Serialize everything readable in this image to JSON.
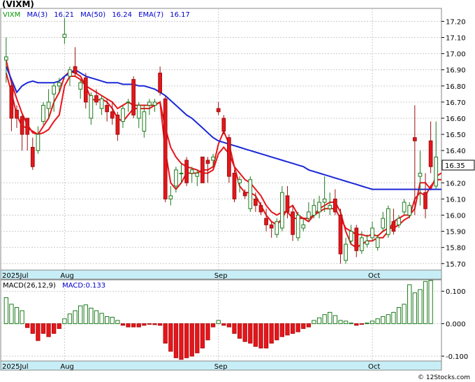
{
  "chart_data": {
    "type": "candlestick",
    "symbol": "(VIXM)",
    "legend": [
      {
        "label": "VIXM",
        "color": "#009900"
      },
      {
        "label": "MA(3)",
        "color": "#0000cc"
      },
      {
        "label": "16.21",
        "color": "#0000cc"
      },
      {
        "label": "MA(50)",
        "color": "#0000cc"
      },
      {
        "label": "16.24",
        "color": "#0000cc"
      },
      {
        "label": "EMA(7)",
        "color": "#0000cc"
      },
      {
        "label": "16.17",
        "color": "#0000cc"
      }
    ],
    "last_price_label": "16.35",
    "y_ticks": [
      "17.20",
      "17.10",
      "17.00",
      "16.90",
      "16.80",
      "16.70",
      "16.60",
      "16.50",
      "16.40",
      "16.35",
      "16.20",
      "16.10",
      "16.00",
      "15.90",
      "15.80",
      "15.70"
    ],
    "ylim": [
      15.66,
      17.28
    ],
    "x_labels": [
      {
        "text": "2025Jul",
        "index": 0
      },
      {
        "text": "Aug",
        "index": 11.5
      },
      {
        "text": "Sep",
        "index": 40.5
      },
      {
        "text": "Oct",
        "index": 69.5
      }
    ],
    "ohlc": [
      [
        16.96,
        17.1,
        16.82,
        16.98
      ],
      [
        16.8,
        16.82,
        16.52,
        16.6
      ],
      [
        16.65,
        16.68,
        16.54,
        16.6
      ],
      [
        16.61,
        16.62,
        16.4,
        16.5
      ],
      [
        16.6,
        16.6,
        16.4,
        16.5
      ],
      [
        16.42,
        16.48,
        16.28,
        16.3
      ],
      [
        16.4,
        16.55,
        16.38,
        16.5
      ],
      [
        16.58,
        16.7,
        16.56,
        16.68
      ],
      [
        16.66,
        16.78,
        16.6,
        16.7
      ],
      [
        16.75,
        16.82,
        16.64,
        16.8
      ],
      [
        16.8,
        16.85,
        16.76,
        16.82
      ],
      [
        17.1,
        17.22,
        17.06,
        17.12
      ],
      [
        16.86,
        16.92,
        16.8,
        16.9
      ],
      [
        16.92,
        17.04,
        16.86,
        16.88
      ],
      [
        16.78,
        16.84,
        16.72,
        16.82
      ],
      [
        16.85,
        16.88,
        16.66,
        16.7
      ],
      [
        16.6,
        16.76,
        16.56,
        16.74
      ],
      [
        16.74,
        16.78,
        16.68,
        16.7
      ],
      [
        16.66,
        16.74,
        16.62,
        16.72
      ],
      [
        16.68,
        16.72,
        16.58,
        16.64
      ],
      [
        16.64,
        16.7,
        16.56,
        16.6
      ],
      [
        16.62,
        16.64,
        16.46,
        16.5
      ],
      [
        16.58,
        16.68,
        16.54,
        16.66
      ],
      [
        16.7,
        16.72,
        16.64,
        16.7
      ],
      [
        16.84,
        16.86,
        16.6,
        16.62
      ],
      [
        16.6,
        16.7,
        16.54,
        16.68
      ],
      [
        16.52,
        16.68,
        16.48,
        16.64
      ],
      [
        16.68,
        16.72,
        16.62,
        16.7
      ],
      [
        16.68,
        16.72,
        16.64,
        16.7
      ],
      [
        16.88,
        16.92,
        16.74,
        16.76
      ],
      [
        16.72,
        16.74,
        16.08,
        16.1
      ],
      [
        16.1,
        16.18,
        16.06,
        16.12
      ],
      [
        16.18,
        16.3,
        16.14,
        16.28
      ],
      [
        16.26,
        16.32,
        16.2,
        16.26
      ],
      [
        16.34,
        16.36,
        16.18,
        16.2
      ],
      [
        16.26,
        16.3,
        16.2,
        16.28
      ],
      [
        16.24,
        16.28,
        16.18,
        16.26
      ],
      [
        16.36,
        16.36,
        16.2,
        16.2
      ],
      [
        16.34,
        16.36,
        16.2,
        16.32
      ],
      [
        16.34,
        16.38,
        16.3,
        16.36
      ],
      [
        16.66,
        16.7,
        16.62,
        16.64
      ],
      [
        16.6,
        16.62,
        16.5,
        16.52
      ],
      [
        16.48,
        16.5,
        16.2,
        16.24
      ],
      [
        16.26,
        16.28,
        16.08,
        16.1
      ],
      [
        16.2,
        16.24,
        16.14,
        16.22
      ],
      [
        16.14,
        16.16,
        16.1,
        16.12
      ],
      [
        16.04,
        16.24,
        16.02,
        16.22
      ],
      [
        16.1,
        16.14,
        16.02,
        16.06
      ],
      [
        16.06,
        16.08,
        16.0,
        16.02
      ],
      [
        15.98,
        16.04,
        15.9,
        15.94
      ],
      [
        15.94,
        15.96,
        15.86,
        15.92
      ],
      [
        15.88,
        15.98,
        15.86,
        15.96
      ],
      [
        15.92,
        16.18,
        15.9,
        16.14
      ],
      [
        16.12,
        16.18,
        15.98,
        16.02
      ],
      [
        16.02,
        16.06,
        15.84,
        15.88
      ],
      [
        15.86,
        16.02,
        15.84,
        16.0
      ],
      [
        15.92,
        15.98,
        15.9,
        15.94
      ],
      [
        15.98,
        16.08,
        15.96,
        16.02
      ],
      [
        16.0,
        16.1,
        15.98,
        16.06
      ],
      [
        16.02,
        16.12,
        15.98,
        16.08
      ],
      [
        16.08,
        16.24,
        16.02,
        16.1
      ],
      [
        16.04,
        16.14,
        16.0,
        16.06
      ],
      [
        16.1,
        16.16,
        16.0,
        16.02
      ],
      [
        16.0,
        16.04,
        15.7,
        15.76
      ],
      [
        15.72,
        15.86,
        15.7,
        15.82
      ],
      [
        15.84,
        15.94,
        15.82,
        15.9
      ],
      [
        15.92,
        15.94,
        15.74,
        15.78
      ],
      [
        15.78,
        15.9,
        15.76,
        15.86
      ],
      [
        15.82,
        15.88,
        15.8,
        15.84
      ],
      [
        15.86,
        15.96,
        15.84,
        15.92
      ],
      [
        15.8,
        15.88,
        15.78,
        15.86
      ],
      [
        15.92,
        16.02,
        15.9,
        15.98
      ],
      [
        15.88,
        16.06,
        15.86,
        16.04
      ],
      [
        15.96,
        16.04,
        15.88,
        15.9
      ],
      [
        15.94,
        16.0,
        15.92,
        15.98
      ],
      [
        16.02,
        16.1,
        16.0,
        16.08
      ],
      [
        16.0,
        16.08,
        15.98,
        16.06
      ],
      [
        16.48,
        16.68,
        16.0,
        16.46
      ],
      [
        16.24,
        16.4,
        16.06,
        16.26
      ],
      [
        16.14,
        16.26,
        15.98,
        16.04
      ],
      [
        16.46,
        16.58,
        16.26,
        16.3
      ],
      [
        16.18,
        16.58,
        16.16,
        16.36
      ]
    ],
    "ma3": [
      16.92,
      16.84,
      16.76,
      16.8,
      16.82,
      16.83,
      16.82,
      16.82,
      16.82,
      16.82,
      16.83,
      16.86,
      16.88,
      16.9,
      16.88,
      16.86,
      16.85,
      16.84,
      16.83,
      16.82,
      16.82,
      16.82,
      16.81,
      16.81,
      16.81,
      16.8,
      16.8,
      16.79,
      16.78,
      16.76,
      16.74,
      16.71,
      16.68,
      16.65,
      16.62,
      16.6,
      16.57,
      16.54,
      16.51,
      16.48,
      16.46,
      16.45,
      16.44,
      16.43,
      16.42,
      16.41,
      16.4,
      16.39,
      16.38,
      16.37,
      16.36,
      16.35,
      16.34,
      16.33,
      16.32,
      16.31,
      16.3,
      16.28,
      16.27,
      16.26,
      16.25,
      16.24,
      16.23,
      16.22,
      16.21,
      16.2,
      16.19,
      16.18,
      16.17,
      16.16,
      16.16,
      16.16,
      16.16,
      16.16,
      16.16,
      16.16,
      16.16,
      16.16,
      16.16,
      16.16,
      16.16,
      16.16,
      16.16
    ],
    "ma50": [
      16.88,
      16.76,
      16.62,
      16.55,
      16.54,
      16.52,
      16.5,
      16.55,
      16.6,
      16.7,
      16.76,
      16.86,
      16.89,
      16.88,
      16.86,
      16.8,
      16.72,
      16.71,
      16.72,
      16.7,
      16.66,
      16.6,
      16.58,
      16.62,
      16.66,
      16.66,
      16.66,
      16.66,
      16.68,
      16.7,
      16.4,
      16.2,
      16.16,
      16.2,
      16.26,
      16.26,
      16.26,
      16.28,
      16.28,
      16.3,
      16.44,
      16.52,
      16.44,
      16.3,
      16.18,
      16.14,
      16.14,
      16.12,
      16.06,
      16.0,
      15.96,
      15.94,
      15.98,
      16.04,
      16.06,
      16.0,
      15.98,
      15.96,
      16.0,
      16.04,
      16.06,
      16.08,
      16.08,
      16.02,
      15.9,
      15.82,
      15.8,
      15.82,
      15.84,
      15.84,
      15.86,
      15.86,
      15.9,
      15.96,
      15.98,
      16.0,
      16.0,
      16.04,
      16.2,
      16.2,
      16.16,
      16.24,
      16.26
    ],
    "ema7": [
      16.96,
      16.82,
      16.72,
      16.63,
      16.56,
      16.51,
      16.5,
      16.51,
      16.53,
      16.58,
      16.62,
      16.8,
      16.86,
      16.86,
      16.84,
      16.8,
      16.78,
      16.76,
      16.74,
      16.72,
      16.7,
      16.66,
      16.68,
      16.7,
      16.68,
      16.68,
      16.68,
      16.68,
      16.68,
      16.7,
      16.54,
      16.42,
      16.36,
      16.32,
      16.3,
      16.29,
      16.28,
      16.26,
      16.26,
      16.28,
      16.38,
      16.42,
      16.38,
      16.3,
      16.26,
      16.22,
      16.2,
      16.16,
      16.12,
      16.06,
      16.02,
      16.0,
      16.02,
      16.02,
      15.98,
      15.98,
      15.98,
      15.98,
      16.0,
      16.02,
      16.04,
      16.04,
      16.04,
      15.98,
      15.92,
      15.9,
      15.88,
      15.88,
      15.87,
      15.88,
      15.87,
      15.9,
      15.92,
      15.92,
      15.94,
      15.97,
      15.99,
      16.1,
      16.14,
      16.12,
      16.18,
      16.22,
      16.22
    ],
    "macd_label": "MACD(26,12,9)",
    "macd_value_label": "MACD:0.133",
    "macd_ticks": [
      "0.100",
      "0.000",
      "-0.100"
    ],
    "macd_ylim": [
      -0.115,
      0.135
    ],
    "macd": [
      0.08,
      0.06,
      0.05,
      0.04,
      -0.012,
      -0.03,
      -0.052,
      -0.03,
      -0.04,
      -0.03,
      -0.015,
      0.015,
      0.03,
      0.04,
      0.055,
      0.058,
      0.048,
      0.04,
      0.032,
      0.022,
      0.02,
      0.01,
      -0.005,
      -0.01,
      -0.01,
      -0.01,
      -0.005,
      -0.002,
      -0.003,
      -0.005,
      -0.06,
      -0.085,
      -0.105,
      -0.11,
      -0.105,
      -0.1,
      -0.09,
      -0.075,
      -0.05,
      -0.01,
      0.01,
      -0.005,
      -0.01,
      -0.03,
      -0.045,
      -0.055,
      -0.06,
      -0.07,
      -0.075,
      -0.075,
      -0.06,
      -0.05,
      -0.04,
      -0.035,
      -0.03,
      -0.025,
      -0.015,
      -0.01,
      0.01,
      0.018,
      0.028,
      0.035,
      0.025,
      0.01,
      0.008,
      0.002,
      -0.005,
      -0.002,
      0.002,
      0.008,
      0.015,
      0.022,
      0.028,
      0.035,
      0.05,
      0.06,
      0.12,
      0.095,
      0.105,
      0.13,
      0.133
    ]
  }
}
